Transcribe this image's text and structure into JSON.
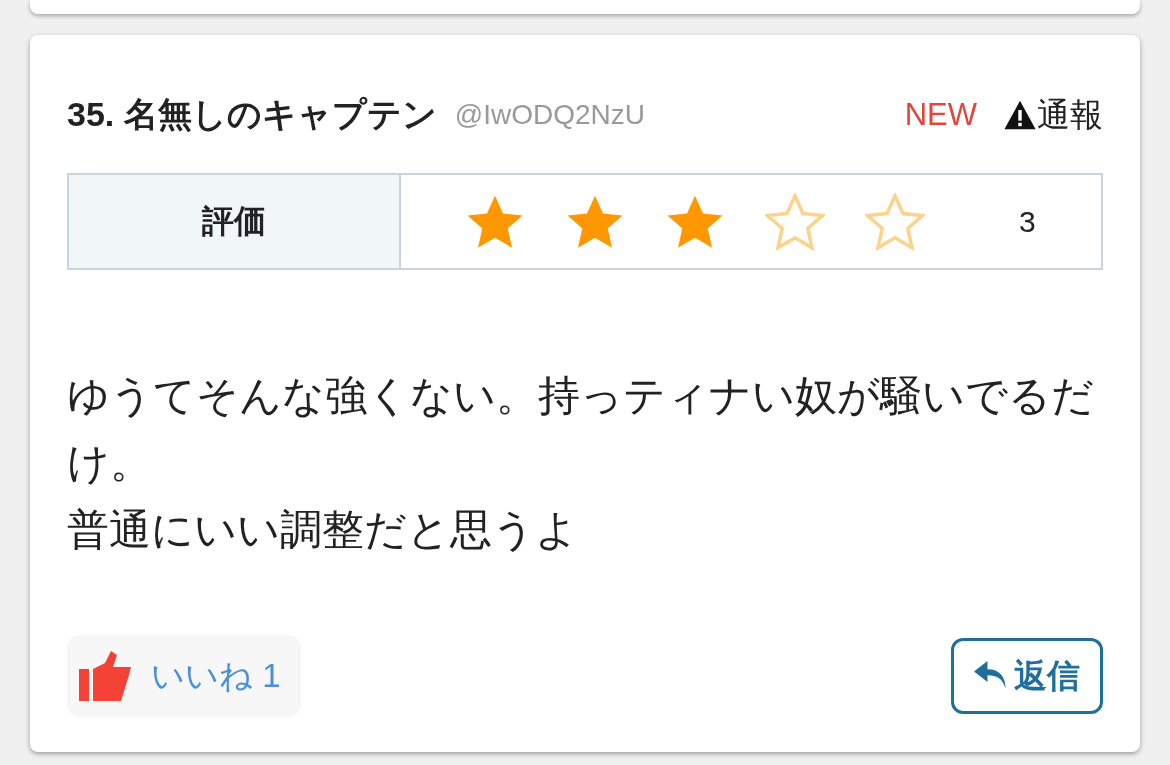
{
  "comment": {
    "title": "35. 名無しのキャプテン",
    "handle": "@IwODQ2NzU",
    "new_label": "NEW",
    "report": "通報",
    "rating": {
      "label": "評価",
      "stars": 3,
      "value": "3"
    },
    "body": [
      "ゆうてそんな強くない。持っティナい奴が騒いでるだけ。",
      "普通にいい調整だと思うよ"
    ],
    "like": "いいね 1",
    "reply": "返信"
  }
}
